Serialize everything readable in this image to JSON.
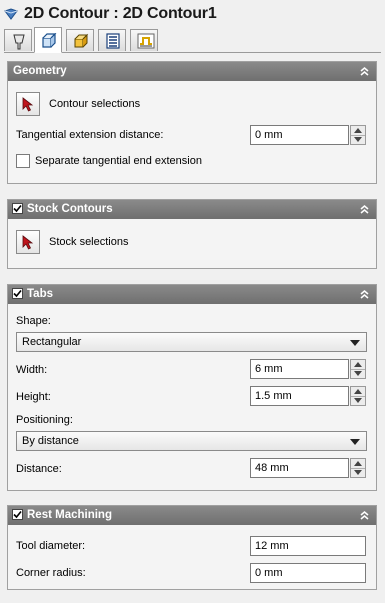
{
  "header": {
    "title": "2D Contour : 2D Contour1"
  },
  "tabs": [
    {
      "name": "tool-tab",
      "icon": "tool-icon",
      "active": false
    },
    {
      "name": "geometry-tab",
      "icon": "geometry-icon",
      "active": true
    },
    {
      "name": "heights-tab",
      "icon": "heights-icon",
      "active": false
    },
    {
      "name": "passes-tab",
      "icon": "passes-icon",
      "active": false
    },
    {
      "name": "linking-tab",
      "icon": "linking-icon",
      "active": false
    }
  ],
  "geometry": {
    "title": "Geometry",
    "contour_button": "Contour selections",
    "tangential_label": "Tangential extension distance:",
    "tangential_value": "0 mm",
    "separate_label": "Separate tangential end extension",
    "separate_checked": false
  },
  "stock_contours": {
    "title": "Stock Contours",
    "enabled": true,
    "stock_button": "Stock selections"
  },
  "tabs_panel": {
    "title": "Tabs",
    "enabled": true,
    "shape_label": "Shape:",
    "shape_value": "Rectangular",
    "width_label": "Width:",
    "width_value": "6 mm",
    "height_label": "Height:",
    "height_value": "1.5 mm",
    "positioning_label": "Positioning:",
    "positioning_value": "By distance",
    "distance_label": "Distance:",
    "distance_value": "48 mm"
  },
  "rest_machining": {
    "title": "Rest Machining",
    "enabled": true,
    "tool_diameter_label": "Tool diameter:",
    "tool_diameter_value": "12 mm",
    "corner_radius_label": "Corner radius:",
    "corner_radius_value": "0 mm"
  },
  "colors": {
    "panel_header": "#7c7c7c",
    "panel_body": "#f4f4f4",
    "cursor_red": "#c0141c"
  }
}
